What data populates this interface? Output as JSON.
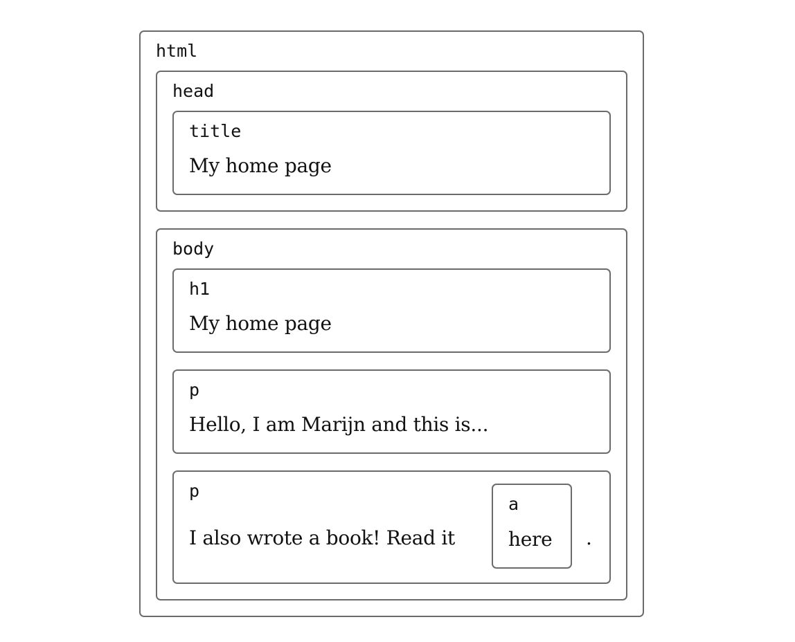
{
  "html_node": {
    "tag": "html"
  },
  "head_node": {
    "tag": "head"
  },
  "title_node": {
    "tag": "title",
    "text": "My home page"
  },
  "body_node": {
    "tag": "body"
  },
  "h1_node": {
    "tag": "h1",
    "text": "My home page"
  },
  "p1_node": {
    "tag": "p",
    "text": "Hello, I am Marijn and this is..."
  },
  "p2_node": {
    "tag": "p",
    "text": "I also wrote a book! Read it",
    "trailing_text": "."
  },
  "a_node": {
    "tag": "a",
    "text": "here"
  },
  "colors": {
    "border": "#6b6b6b",
    "text": "#111111",
    "background": "#ffffff"
  }
}
